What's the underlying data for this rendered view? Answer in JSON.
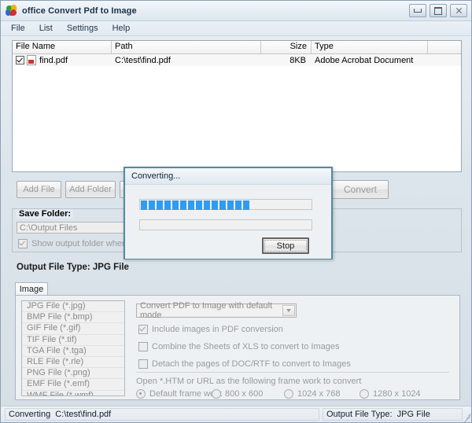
{
  "window": {
    "title": "office Convert Pdf to Image",
    "icon": "app-butterfly-icon",
    "buttons": {
      "minimize": "minimize",
      "maximize": "maximize",
      "close": "close"
    }
  },
  "menubar": {
    "items": [
      {
        "label": "File"
      },
      {
        "label": "List"
      },
      {
        "label": "Settings"
      },
      {
        "label": "Help"
      }
    ]
  },
  "filelist": {
    "columns": [
      "File Name",
      "Path",
      "Size",
      "Type",
      ""
    ],
    "rows": [
      {
        "checked": true,
        "name": "find.pdf",
        "path": "C:\\test\\find.pdf",
        "size": "8KB",
        "type": "Adobe Acrobat Document"
      }
    ]
  },
  "toolbar": {
    "add_file": "Add File",
    "add_folder": "Add Folder",
    "third_button": "",
    "convert": "Convert"
  },
  "save_folder": {
    "group_label": "Save Folder:",
    "path": "C:\\Output Files",
    "show_output_label": "Show output folder when done",
    "show_output_checked": true
  },
  "output_type": {
    "line": "Output File Type:  JPG File"
  },
  "tabs": [
    {
      "label": "Image",
      "active": true
    }
  ],
  "file_types": [
    "JPG File  (*.jpg)",
    "BMP File  (*.bmp)",
    "GIF File  (*.gif)",
    "TIF File  (*.tif)",
    "TGA File  (*.tga)",
    "RLE File  (*.rle)",
    "PNG File  (*.png)",
    "EMF File  (*.emf)",
    "WMF File  (*.wmf)"
  ],
  "options": {
    "mode_select_value": "Convert PDF to Image with default mode",
    "include_images": {
      "label": "Include images in PDF conversion",
      "checked": true
    },
    "combine_xls": {
      "label": "Combine the Sheets of XLS to convert to Images",
      "checked": false
    },
    "detach_doc": {
      "label": "Detach the pages of DOC/RTF to convert to Images",
      "checked": false
    }
  },
  "framework": {
    "label": "Open *.HTM or URL as the following frame work to convert",
    "options": [
      {
        "label": "Default frame work",
        "selected": true
      },
      {
        "label": "800 x 600",
        "selected": false
      },
      {
        "label": "1024 x 768",
        "selected": false
      },
      {
        "label": "1280 x 1024",
        "selected": false
      }
    ]
  },
  "statusbar": {
    "left": "Converting  C:\\test\\find.pdf",
    "right": "Output File Type:  JPG File"
  },
  "dialog": {
    "title": "Converting...",
    "progress_blocks": 14,
    "progress_total_blocks": 22,
    "progress_percent": 59,
    "secondary_progress_percent": 0,
    "stop_label": "Stop",
    "accent_color": "#2f9cf4",
    "border_color": "#4f8ba3"
  }
}
